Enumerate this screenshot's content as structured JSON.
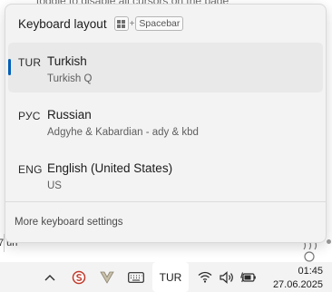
{
  "background": {
    "top_text": "toggle to disable all cursors on the page",
    "left_text": "7 un"
  },
  "flyout": {
    "title": "Keyboard layout",
    "shortcut": {
      "plus": "+",
      "key": "Spacebar"
    },
    "languages": [
      {
        "code": "TUR",
        "name": "Turkish",
        "layout": "Turkish Q",
        "selected": true
      },
      {
        "code": "РУС",
        "name": "Russian",
        "layout": "Adgyhe & Kabardian - ady & kbd",
        "selected": false
      },
      {
        "code": "ENG",
        "name": "English (United States)",
        "layout": "US",
        "selected": false
      }
    ],
    "more_link": "More keyboard settings"
  },
  "taskbar": {
    "lang_indicator": "TUR",
    "time": "01:45",
    "date": "27.06.2025"
  },
  "colors": {
    "accent": "#005fb8",
    "flyout_bg": "#f3f3f3",
    "selected_bg": "#e9e9e9"
  }
}
